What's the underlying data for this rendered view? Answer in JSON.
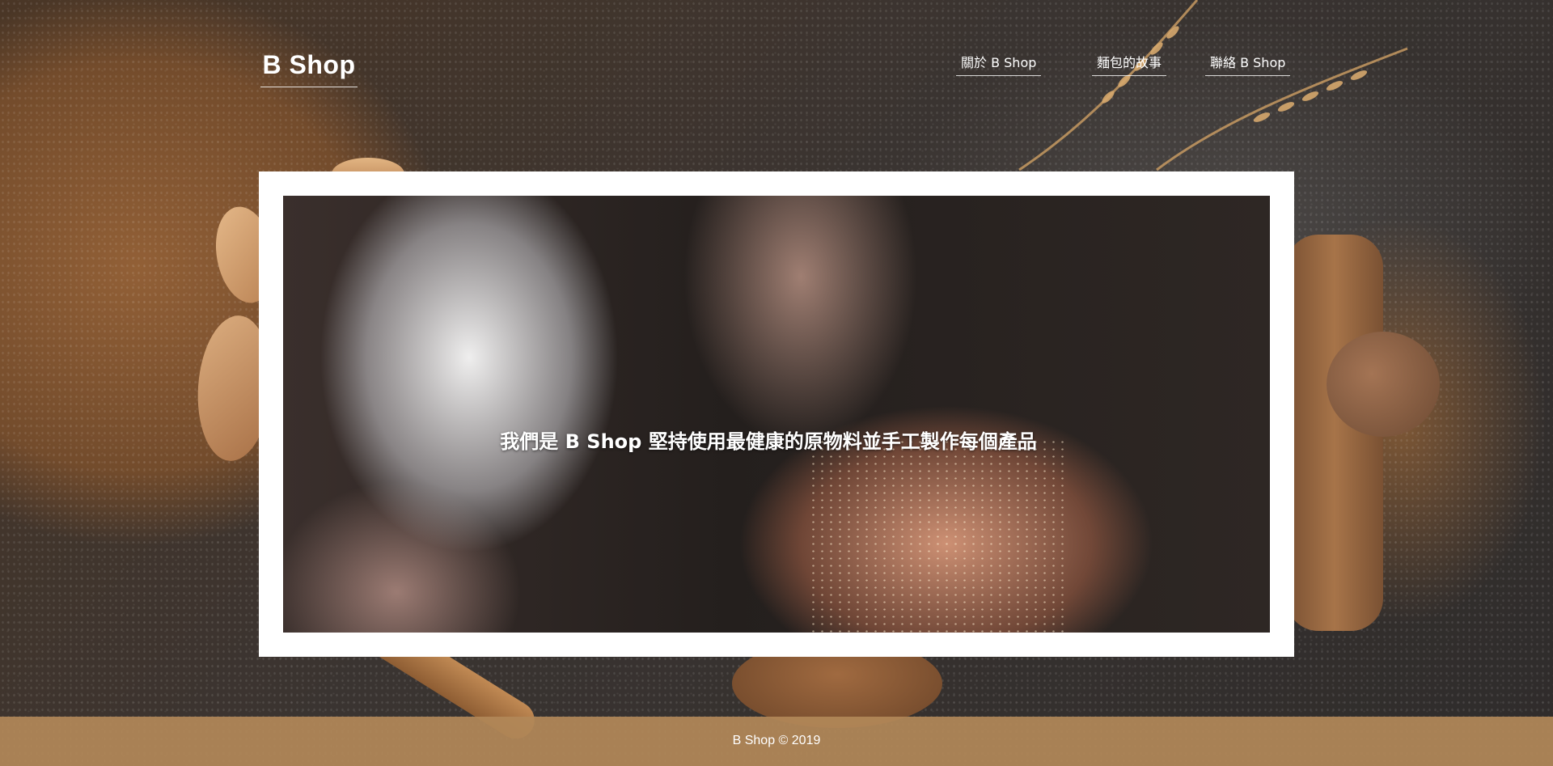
{
  "header": {
    "logo": "B Shop",
    "nav": [
      {
        "label": "關於 B Shop"
      },
      {
        "label": "麵包的故事"
      },
      {
        "label": "聯絡 B Shop"
      }
    ]
  },
  "hero": {
    "slogan": "我們是 B Shop 堅持使用最健康的原物料並手工製作每個產品"
  },
  "footer": {
    "copyright": "B Shop © 2019"
  },
  "colors": {
    "footer_bg": "#b28858",
    "frame": "#ffffff",
    "text": "#ffffff"
  }
}
